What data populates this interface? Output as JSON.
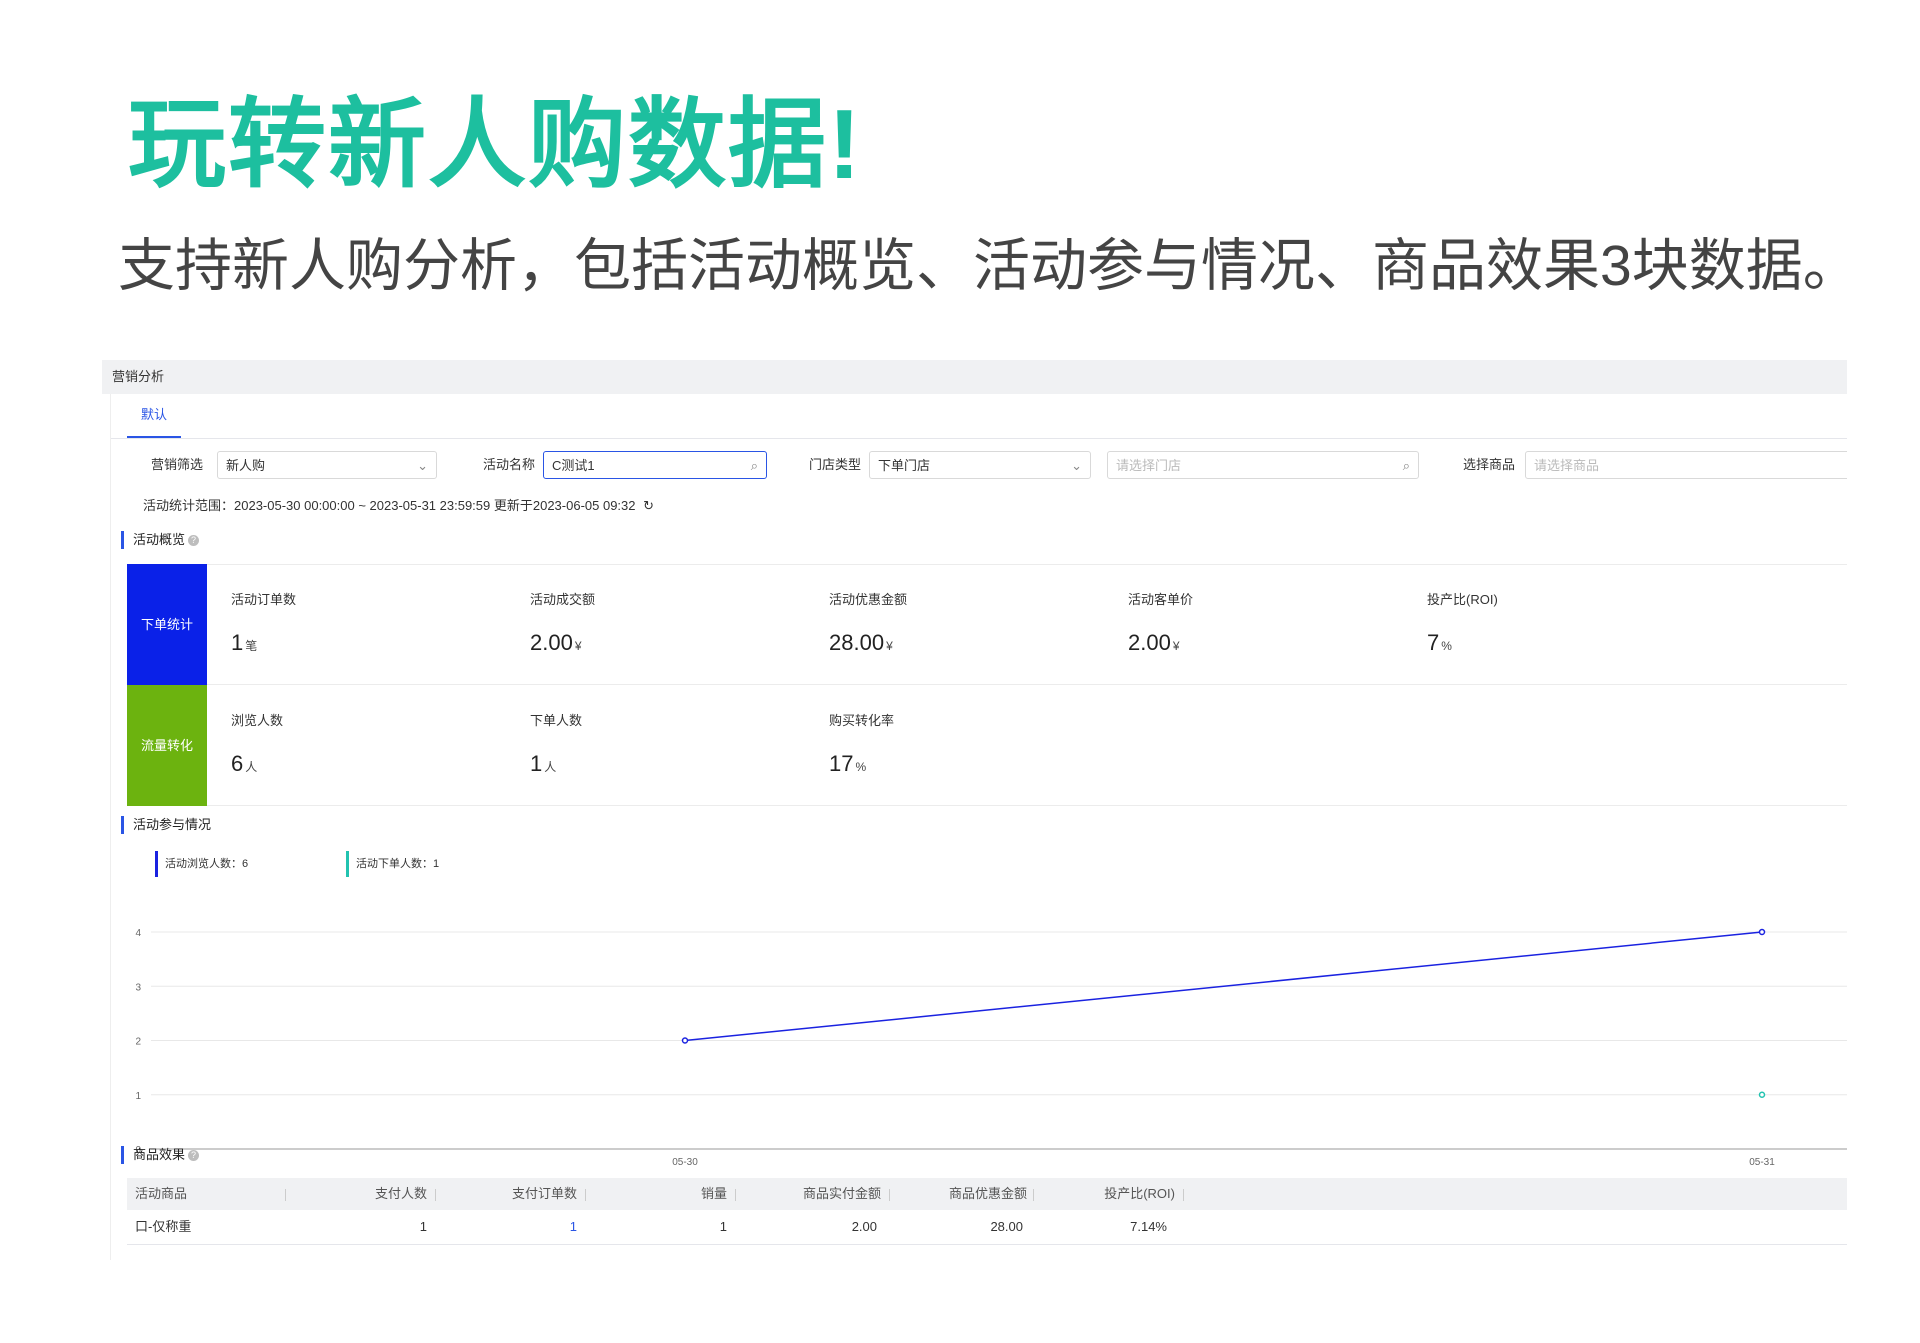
{
  "headline": "玩转新人购数据!",
  "subheadline": "支持新人购分析，包括活动概览、活动参与情况、商品效果3块数据。",
  "panel": {
    "breadcrumb": "营销分析",
    "tab": "默认",
    "filters": {
      "marketing_label": "营销筛选",
      "marketing_value": "新人购",
      "activity_label": "活动名称",
      "activity_value": "C测试1",
      "store_type_label": "门店类型",
      "store_type_value": "下单门店",
      "store_placeholder": "请选择门店",
      "product_label": "选择商品",
      "product_placeholder": "请选择商品"
    },
    "range_text": "活动统计范围：2023-05-30 00:00:00 ~ 2023-05-31 23:59:59  更新于2023-06-05 09:32",
    "overview": {
      "title": "活动概览",
      "rows": [
        {
          "label": "下单统计",
          "color": "#0a21e8",
          "metrics": [
            {
              "label": "活动订单数",
              "value": "1",
              "unit": "笔"
            },
            {
              "label": "活动成交额",
              "value": "2.00",
              "unit": "¥"
            },
            {
              "label": "活动优惠金额",
              "value": "28.00",
              "unit": "¥"
            },
            {
              "label": "活动客单价",
              "value": "2.00",
              "unit": "¥"
            },
            {
              "label": "投产比(ROI)",
              "value": "7",
              "unit": "%"
            }
          ]
        },
        {
          "label": "流量转化",
          "color": "#6cb30f",
          "metrics": [
            {
              "label": "浏览人数",
              "value": "6",
              "unit": "人"
            },
            {
              "label": "下单人数",
              "value": "1",
              "unit": "人"
            },
            {
              "label": "购买转化率",
              "value": "17",
              "unit": "%"
            }
          ]
        }
      ]
    },
    "participation": {
      "title": "活动参与情况",
      "legend": [
        {
          "label": "活动浏览人数：6",
          "color": "#1a22e0"
        },
        {
          "label": "活动下单人数：1",
          "color": "#22c3b0"
        }
      ]
    },
    "product_effect": {
      "title": "商品效果",
      "columns": [
        "活动商品",
        "支付人数",
        "支付订单数",
        "销量",
        "商品实付金额",
        "商品优惠金额",
        "投产比(ROI)"
      ],
      "rows": [
        [
          "口-仅称重",
          "1",
          "1",
          "1",
          "2.00",
          "28.00",
          "7.14%"
        ]
      ]
    }
  },
  "chart_data": {
    "type": "line",
    "x": [
      "05-30",
      "05-31"
    ],
    "ylim": [
      0,
      4
    ],
    "yticks": [
      0,
      1,
      2,
      3,
      4
    ],
    "grid": true,
    "legend_position": "top-left",
    "series": [
      {
        "name": "活动浏览人数",
        "values": [
          2,
          4
        ],
        "color": "#1a22e0"
      },
      {
        "name": "活动下单人数",
        "values": [
          null,
          1
        ],
        "color": "#22c3b0"
      }
    ]
  }
}
